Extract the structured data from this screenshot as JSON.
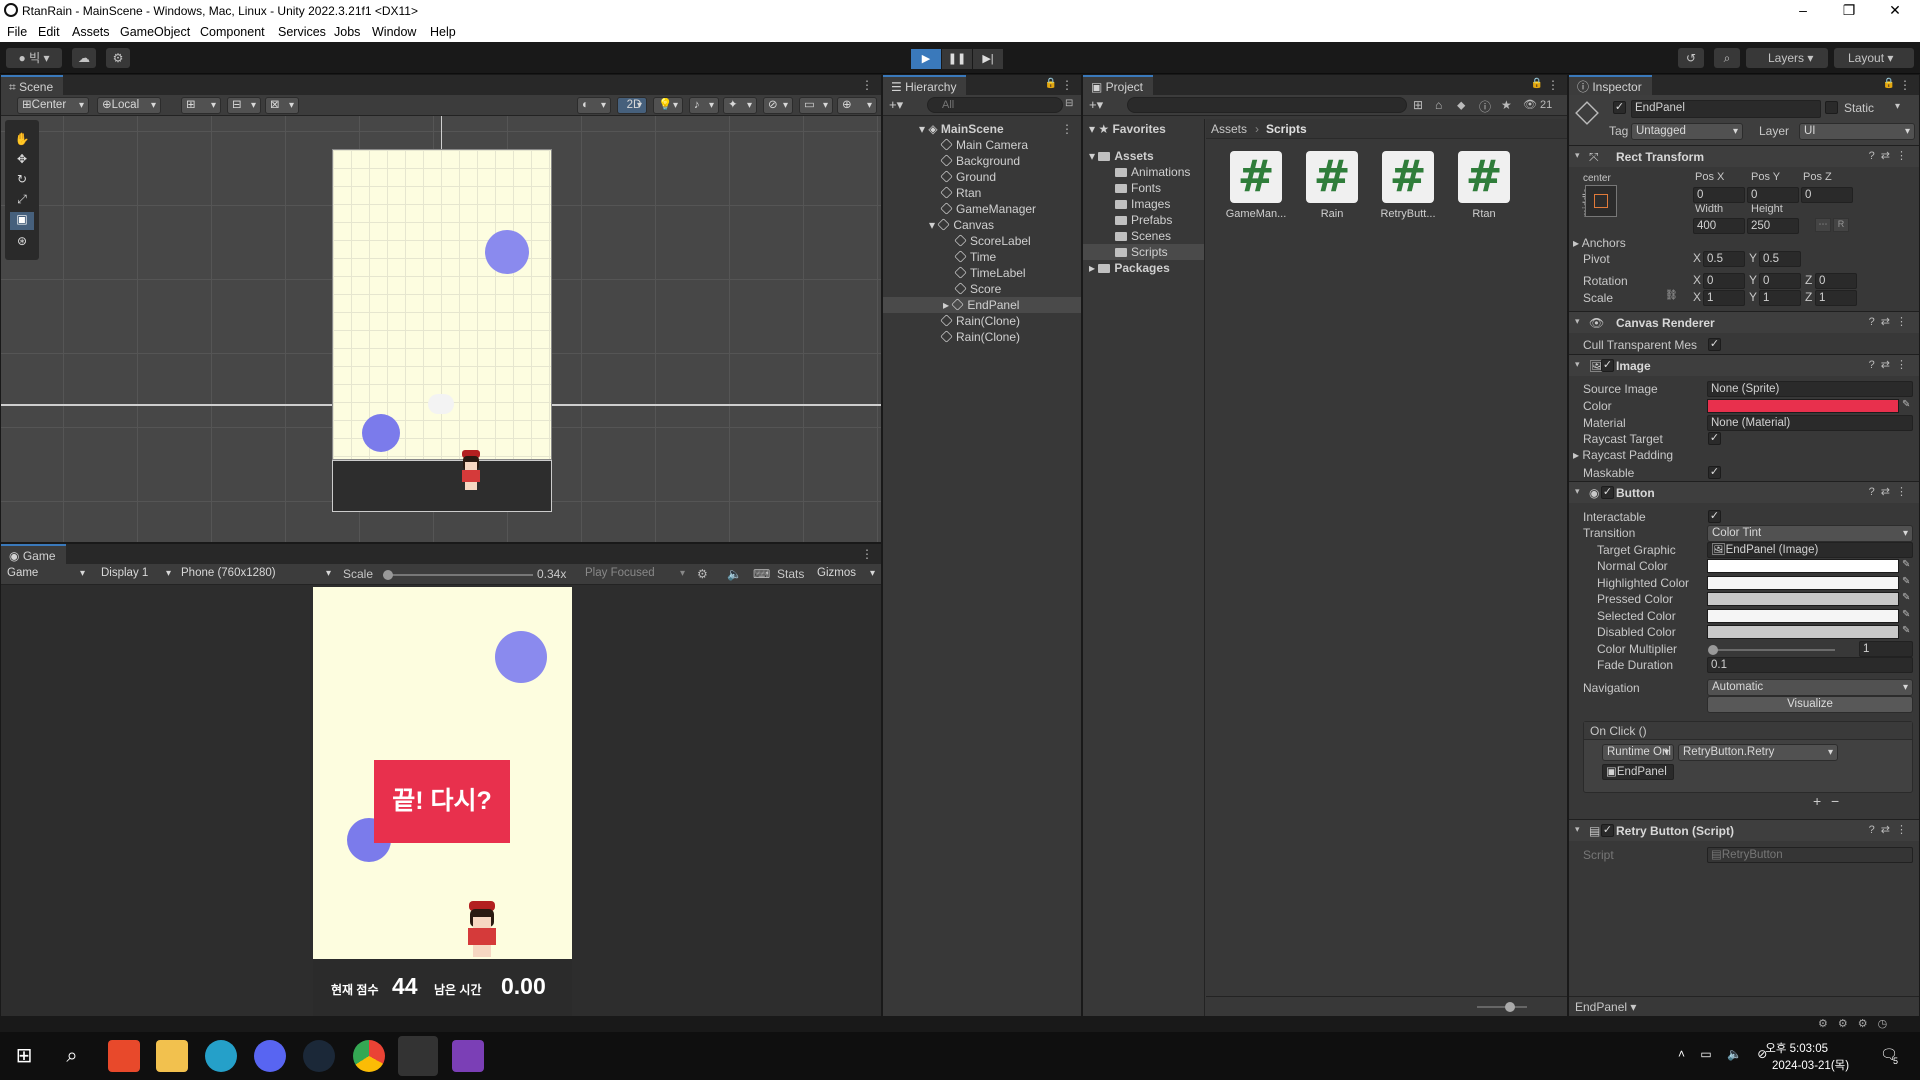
{
  "window": {
    "title": "RtanRain - MainScene - Windows, Mac, Linux - Unity 2022.3.21f1 <DX11>",
    "minimize": "–",
    "maximize": "❐",
    "close": "✕"
  },
  "menu": [
    "File",
    "Edit",
    "Assets",
    "GameObject",
    "Component",
    "Services",
    "Jobs",
    "Window",
    "Help"
  ],
  "toolbar": {
    "account": "빅",
    "layers_label": "Layers",
    "layout_label": "Layout"
  },
  "scene": {
    "tab": "Scene",
    "pivot": "Center",
    "space": "Local",
    "mode_2d": "2D"
  },
  "game": {
    "tab": "Game",
    "display_type": "Game",
    "display": "Display 1",
    "resolution": "Phone (760x1280)",
    "scale_label": "Scale",
    "scale_value": "0.34x",
    "play_focused": "Play Focused",
    "stats": "Stats",
    "gizmos": "Gizmos",
    "end_text": "끝! 다시?",
    "score_label": "현재 점수",
    "score_value": "44",
    "time_label": "남은 시간",
    "time_value": "0.00"
  },
  "hierarchy": {
    "tab": "Hierarchy",
    "search_placeholder": "All",
    "scene_name": "MainScene",
    "items": [
      {
        "label": "Main Camera",
        "depth": 1
      },
      {
        "label": "Background",
        "depth": 1
      },
      {
        "label": "Ground",
        "depth": 1
      },
      {
        "label": "Rtan",
        "depth": 1
      },
      {
        "label": "GameManager",
        "depth": 1
      },
      {
        "label": "Canvas",
        "depth": 1
      },
      {
        "label": "ScoreLabel",
        "depth": 2
      },
      {
        "label": "Time",
        "depth": 2
      },
      {
        "label": "TimeLabel",
        "depth": 2
      },
      {
        "label": "Score",
        "depth": 2
      },
      {
        "label": "EndPanel",
        "depth": 2
      },
      {
        "label": "Rain(Clone)",
        "depth": 1
      },
      {
        "label": "Rain(Clone)",
        "depth": 1
      }
    ]
  },
  "project": {
    "tab": "Project",
    "hidden_count": "21",
    "favorites": "Favorites",
    "assets_root": "Assets",
    "folders": [
      "Animations",
      "Fonts",
      "Images",
      "Prefabs",
      "Scenes",
      "Scripts"
    ],
    "packages": "Packages",
    "breadcrumb": [
      "Assets",
      "Scripts"
    ],
    "files": [
      "GameMan...",
      "Rain",
      "RetryButt...",
      "Rtan"
    ]
  },
  "inspector": {
    "tab": "Inspector",
    "object_name": "EndPanel",
    "static_label": "Static",
    "tag_label": "Tag",
    "tag_value": "Untagged",
    "layer_label": "Layer",
    "layer_value": "UI",
    "rect": {
      "title": "Rect Transform",
      "anchor_h": "center",
      "anchor_v": "middle",
      "posx_label": "Pos X",
      "posy_label": "Pos Y",
      "posz_label": "Pos Z",
      "posx": "0",
      "posy": "0",
      "posz": "0",
      "width_label": "Width",
      "height_label": "Height",
      "width": "400",
      "height": "250",
      "anchors": "Anchors",
      "pivot_label": "Pivot",
      "pivot_x": "0.5",
      "pivot_y": "0.5",
      "rotation_label": "Rotation",
      "rot_x": "0",
      "rot_y": "0",
      "rot_z": "0",
      "scale_label": "Scale",
      "scale_x": "1",
      "scale_y": "1",
      "scale_z": "1",
      "x": "X",
      "y": "Y",
      "z": "Z",
      "r": "R"
    },
    "canvas_renderer": {
      "title": "Canvas Renderer",
      "cull_label": "Cull Transparent Mes"
    },
    "image": {
      "title": "Image",
      "source_label": "Source Image",
      "source_value": "None (Sprite)",
      "color_label": "Color",
      "color_value": "#e8304d",
      "material_label": "Material",
      "material_value": "None (Material)",
      "raycast_label": "Raycast Target",
      "padding_label": "Raycast Padding",
      "maskable_label": "Maskable"
    },
    "button": {
      "title": "Button",
      "interactable_label": "Interactable",
      "transition_label": "Transition",
      "transition_value": "Color Tint",
      "target_label": "Target Graphic",
      "target_value": "EndPanel (Image)",
      "normal_label": "Normal Color",
      "highlighted_label": "Highlighted Color",
      "pressed_label": "Pressed Color",
      "selected_label": "Selected Color",
      "disabled_label": "Disabled Color",
      "multiplier_label": "Color Multiplier",
      "multiplier_value": "1",
      "fade_label": "Fade Duration",
      "fade_value": "0.1",
      "navigation_label": "Navigation",
      "navigation_value": "Automatic",
      "visualize": "Visualize",
      "onclick_label": "On Click ()",
      "runtime_value": "Runtime Onl",
      "method_value": "RetryButton.Retry",
      "object_value": "EndPanel",
      "add": "+",
      "remove": "−"
    },
    "retry_script": {
      "title": "Retry Button (Script)",
      "script_label": "Script",
      "script_value": "RetryButton"
    },
    "footer": "EndPanel"
  },
  "taskbar": {
    "time": "오후 5:03:05",
    "date": "2024-03-21(목)",
    "notif": "5"
  }
}
